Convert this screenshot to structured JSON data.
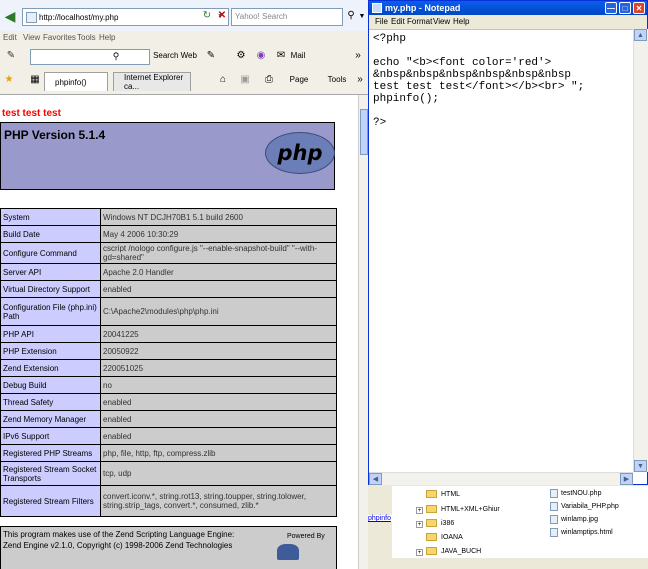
{
  "ie": {
    "address": "http://localhost/my.php",
    "search_placeholder": "Yahoo! Search",
    "menu": [
      "Edit",
      "View",
      "Favorites",
      "Tools",
      "Help"
    ],
    "links_bar": {
      "search_web": "Search Web",
      "mail": "Mail"
    },
    "tabs": [
      "phpinfo()",
      "Internet Explorer ca..."
    ],
    "toolbar": {
      "page": "Page",
      "tools": "Tools"
    },
    "page": {
      "echo_text": "test test test",
      "php_version": "PHP Version 5.1.4",
      "logo_text": "php",
      "rows": [
        {
          "k": "System",
          "v": "Windows NT DCJH70B1 5.1 build 2600"
        },
        {
          "k": "Build Date",
          "v": "May 4 2006 10:30:29"
        },
        {
          "k": "Configure Command",
          "v": "cscript /nologo configure.js \"--enable-snapshot-build\" \"--with-gd=shared\""
        },
        {
          "k": "Server API",
          "v": "Apache 2.0 Handler"
        },
        {
          "k": "Virtual Directory Support",
          "v": "enabled"
        },
        {
          "k": "Configuration File (php.ini) Path",
          "v": "C:\\Apache2\\modules\\php\\php.ini"
        },
        {
          "k": "PHP API",
          "v": "20041225"
        },
        {
          "k": "PHP Extension",
          "v": "20050922"
        },
        {
          "k": "Zend Extension",
          "v": "220051025"
        },
        {
          "k": "Debug Build",
          "v": "no"
        },
        {
          "k": "Thread Safety",
          "v": "enabled"
        },
        {
          "k": "Zend Memory Manager",
          "v": "enabled"
        },
        {
          "k": "IPv6 Support",
          "v": "enabled"
        },
        {
          "k": "Registered PHP Streams",
          "v": "php, file, http, ftp, compress.zlib"
        },
        {
          "k": "Registered Stream Socket Transports",
          "v": "tcp, udp"
        },
        {
          "k": "Registered Stream Filters",
          "v": "convert.iconv.*, string.rot13, string.toupper, string.tolower, string.strip_tags, convert.*, consumed, zlib.*"
        }
      ],
      "zend_line1": "This program makes use of the Zend Scripting Language Engine:",
      "zend_line2": "Zend Engine v2.1.0, Copyright (c) 1998-2006 Zend Technologies",
      "powered_by": "Powered By"
    }
  },
  "notepad": {
    "title": "my.php - Notepad",
    "menu": [
      "File",
      "Edit",
      "Format",
      "View",
      "Help"
    ],
    "content": "<?php\n\necho \"<b><font color='red'>\n&nbsp&nbsp&nbsp&nbsp&nbsp&nbsp\ntest test test</font></b><br> \";\nphpinfo();\n\n?>"
  },
  "explorer": {
    "tree": [
      "HTML",
      "HTML+XML+Ghiur",
      "i386",
      "IOANA",
      "JAVA_BUCH"
    ],
    "files": [
      "testNOU.php",
      "Variabila_PHP.php",
      "winlamp.jpg",
      "winlamptips.html"
    ],
    "peek_text": "phpinfo"
  }
}
